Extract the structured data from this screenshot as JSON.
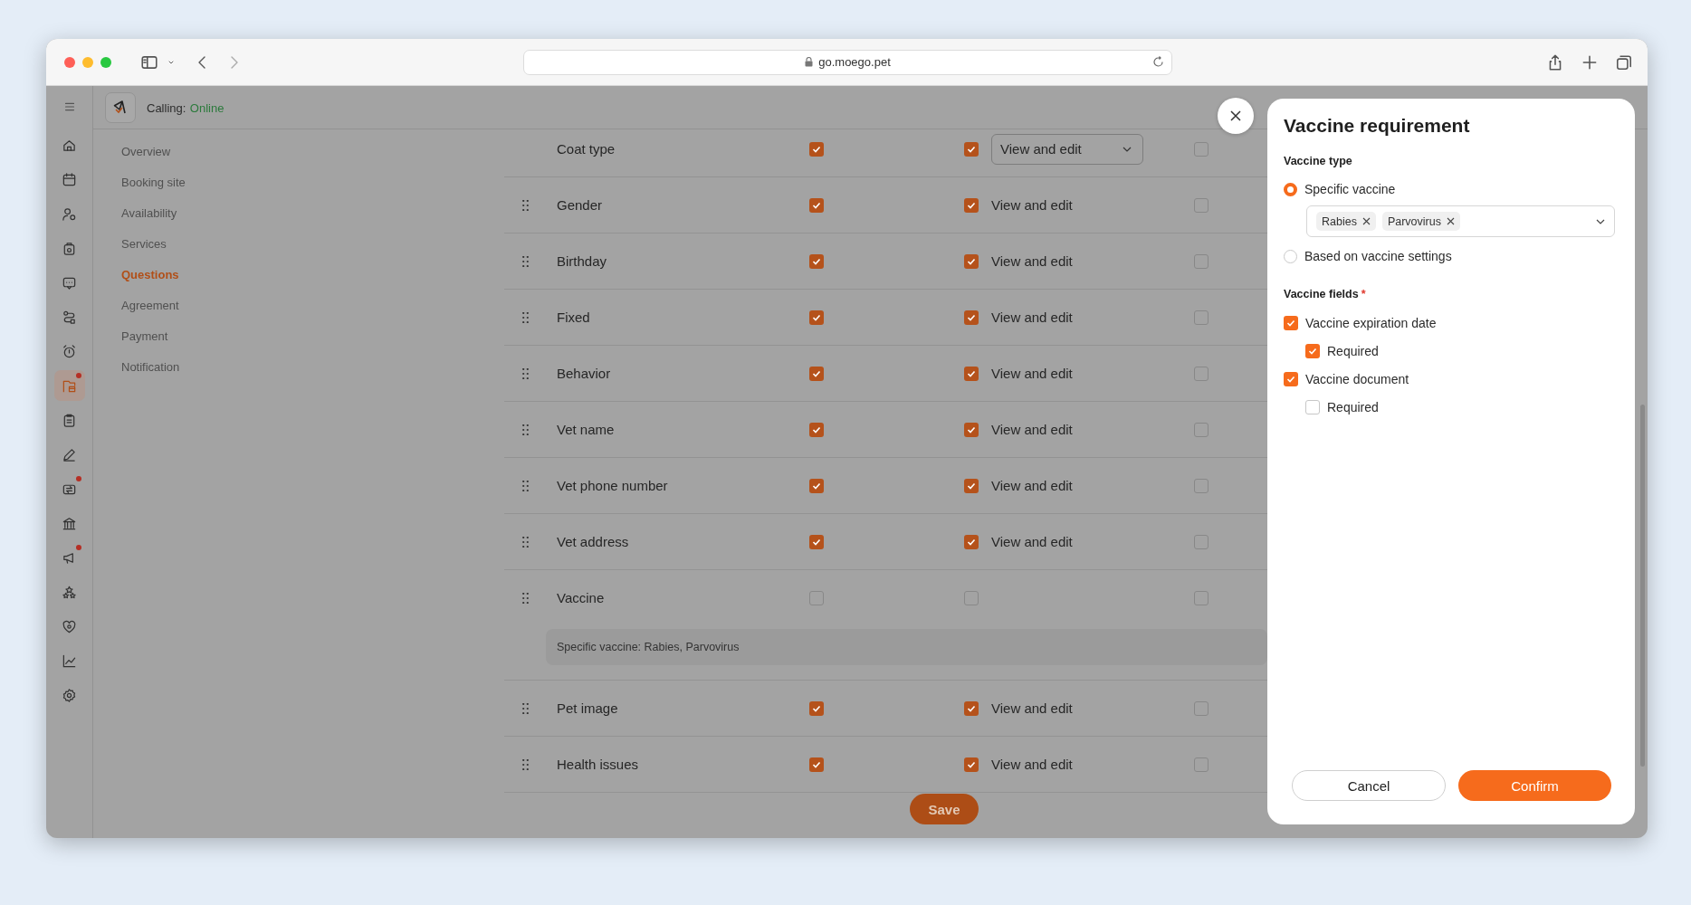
{
  "browser": {
    "url": "go.moego.pet"
  },
  "rail": {
    "items": [
      {
        "selected": false,
        "badge": false
      },
      {
        "selected": false,
        "badge": false
      },
      {
        "selected": false,
        "badge": false
      },
      {
        "selected": false,
        "badge": false
      },
      {
        "selected": false,
        "badge": false
      },
      {
        "selected": false,
        "badge": false
      },
      {
        "selected": false,
        "badge": false
      },
      {
        "selected": true,
        "badge": true
      },
      {
        "selected": false,
        "badge": false
      },
      {
        "selected": false,
        "badge": false
      },
      {
        "selected": false,
        "badge": true
      },
      {
        "selected": false,
        "badge": false
      },
      {
        "selected": false,
        "badge": true
      },
      {
        "selected": false,
        "badge": false
      },
      {
        "selected": false,
        "badge": false
      },
      {
        "selected": false,
        "badge": false
      },
      {
        "selected": false,
        "badge": false
      }
    ]
  },
  "header": {
    "calling_label": "Calling:",
    "calling_status": "Online"
  },
  "subnav": [
    {
      "label": "Overview",
      "selected": false
    },
    {
      "label": "Booking site",
      "selected": false
    },
    {
      "label": "Availability",
      "selected": false
    },
    {
      "label": "Services",
      "selected": false
    },
    {
      "label": "Questions",
      "selected": true
    },
    {
      "label": "Agreement",
      "selected": false
    },
    {
      "label": "Payment",
      "selected": false
    },
    {
      "label": "Notification",
      "selected": false
    }
  ],
  "questions": [
    {
      "name": "Coat type",
      "draggable": false,
      "checked_a": true,
      "checked_b": true,
      "access": "View and edit",
      "kind": "dropdown",
      "checked_c": false
    },
    {
      "name": "Gender",
      "draggable": true,
      "checked_a": true,
      "checked_b": true,
      "access": "View and edit",
      "kind": "text",
      "checked_c": false
    },
    {
      "name": "Birthday",
      "draggable": true,
      "checked_a": true,
      "checked_b": true,
      "access": "View and edit",
      "kind": "text",
      "checked_c": false
    },
    {
      "name": "Fixed",
      "draggable": true,
      "checked_a": true,
      "checked_b": true,
      "access": "View and edit",
      "kind": "text",
      "checked_c": false
    },
    {
      "name": "Behavior",
      "draggable": true,
      "checked_a": true,
      "checked_b": true,
      "access": "View and edit",
      "kind": "text",
      "checked_c": false
    },
    {
      "name": "Vet name",
      "draggable": true,
      "checked_a": true,
      "checked_b": true,
      "access": "View and edit",
      "kind": "text",
      "checked_c": false
    },
    {
      "name": "Vet phone number",
      "draggable": true,
      "checked_a": true,
      "checked_b": true,
      "access": "View and edit",
      "kind": "text",
      "checked_c": false
    },
    {
      "name": "Vet address",
      "draggable": true,
      "checked_a": true,
      "checked_b": true,
      "access": "View and edit",
      "kind": "text",
      "checked_c": false
    },
    {
      "name": "Vaccine",
      "draggable": true,
      "checked_a": false,
      "checked_b": false,
      "checked_c": false,
      "note": "Specific vaccine: Rabies, Parvovirus"
    },
    {
      "name": "Pet image",
      "draggable": true,
      "checked_a": true,
      "checked_b": true,
      "access": "View and edit",
      "kind": "text",
      "checked_c": false
    },
    {
      "name": "Health issues",
      "draggable": true,
      "checked_a": true,
      "checked_b": true,
      "access": "View and edit",
      "kind": "text",
      "checked_c": false
    }
  ],
  "save_button": "Save",
  "modal": {
    "title": "Vaccine requirement",
    "vaccine_type": {
      "label": "Vaccine type",
      "options": [
        {
          "label": "Specific vaccine",
          "selected": true,
          "tags": [
            "Rabies",
            "Parvovirus"
          ]
        },
        {
          "label": "Based on vaccine settings",
          "selected": false
        }
      ]
    },
    "vaccine_fields": {
      "label": "Vaccine fields",
      "required_mark": "*",
      "items": [
        {
          "label": "Vaccine expiration date",
          "checked": true,
          "children": [
            {
              "label": "Required",
              "checked": true
            }
          ]
        },
        {
          "label": "Vaccine document",
          "checked": true,
          "children": [
            {
              "label": "Required",
              "checked": false
            }
          ]
        }
      ]
    },
    "buttons": [
      {
        "label": "Cancel",
        "kind": "secondary"
      },
      {
        "label": "Confirm",
        "kind": "primary"
      }
    ]
  }
}
